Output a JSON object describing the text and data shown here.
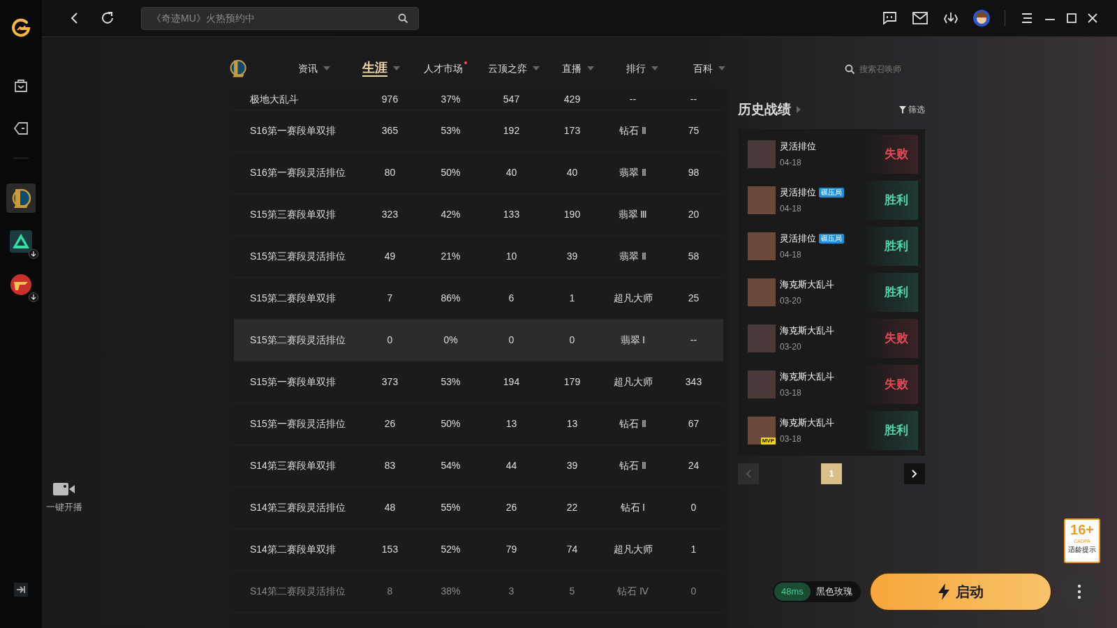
{
  "sidebar": {
    "games": [
      {
        "kind": "lol",
        "selected": true,
        "download": false
      },
      {
        "kind": "triangle",
        "selected": false,
        "download": true
      },
      {
        "kind": "cf",
        "selected": false,
        "download": true
      }
    ],
    "live_button": {
      "label": "一键开播"
    }
  },
  "top_bar": {
    "search": {
      "placeholder": "《奇迹MU》火热预约中"
    }
  },
  "nav": {
    "tabs": [
      {
        "label": "资讯",
        "selected": false,
        "dropdown": true,
        "dot": false
      },
      {
        "label": "生涯",
        "selected": true,
        "dropdown": true,
        "dot": false
      },
      {
        "label": "人才市场",
        "selected": false,
        "dropdown": false,
        "dot": true
      },
      {
        "label": "云顶之弈",
        "selected": false,
        "dropdown": true,
        "dot": false
      },
      {
        "label": "直播",
        "selected": false,
        "dropdown": true,
        "dot": false
      },
      {
        "label": "排行",
        "selected": false,
        "dropdown": true,
        "dot": false
      },
      {
        "label": "百科",
        "selected": false,
        "dropdown": true,
        "dot": false
      }
    ],
    "search": {
      "placeholder": "搜索召唤师"
    }
  },
  "table": {
    "rows": [
      {
        "cells": [
          "极地大乱斗",
          "976",
          "37%",
          "547",
          "429",
          "--",
          "--"
        ],
        "highlighted": false,
        "dimmed": false
      },
      {
        "cells": [
          "S16第一赛段单双排",
          "365",
          "53%",
          "192",
          "173",
          "钻石 Ⅱ",
          "75"
        ],
        "highlighted": false,
        "dimmed": false
      },
      {
        "cells": [
          "S16第一赛段灵活排位",
          "80",
          "50%",
          "40",
          "40",
          "翡翠 Ⅱ",
          "98"
        ],
        "highlighted": false,
        "dimmed": false
      },
      {
        "cells": [
          "S15第三赛段单双排",
          "323",
          "42%",
          "133",
          "190",
          "翡翠 Ⅲ",
          "20"
        ],
        "highlighted": false,
        "dimmed": false
      },
      {
        "cells": [
          "S15第三赛段灵活排位",
          "49",
          "21%",
          "10",
          "39",
          "翡翠 Ⅱ",
          "58"
        ],
        "highlighted": false,
        "dimmed": false
      },
      {
        "cells": [
          "S15第二赛段单双排",
          "7",
          "86%",
          "6",
          "1",
          "超凡大师",
          "25"
        ],
        "highlighted": false,
        "dimmed": false
      },
      {
        "cells": [
          "S15第二赛段灵活排位",
          "0",
          "0%",
          "0",
          "0",
          "翡翠 Ⅰ",
          "--"
        ],
        "highlighted": true,
        "dimmed": false
      },
      {
        "cells": [
          "S15第一赛段单双排",
          "373",
          "53%",
          "194",
          "179",
          "超凡大师",
          "343"
        ],
        "highlighted": false,
        "dimmed": false
      },
      {
        "cells": [
          "S15第一赛段灵活排位",
          "26",
          "50%",
          "13",
          "13",
          "钻石 Ⅱ",
          "67"
        ],
        "highlighted": false,
        "dimmed": false
      },
      {
        "cells": [
          "S14第三赛段单双排",
          "83",
          "54%",
          "44",
          "39",
          "钻石 Ⅱ",
          "24"
        ],
        "highlighted": false,
        "dimmed": false
      },
      {
        "cells": [
          "S14第三赛段灵活排位",
          "48",
          "55%",
          "26",
          "22",
          "钻石 Ⅰ",
          "0"
        ],
        "highlighted": false,
        "dimmed": false
      },
      {
        "cells": [
          "S14第二赛段单双排",
          "153",
          "52%",
          "79",
          "74",
          "超凡大师",
          "1"
        ],
        "highlighted": false,
        "dimmed": false
      },
      {
        "cells": [
          "S14第二赛段灵活排位",
          "8",
          "38%",
          "3",
          "5",
          "钻石 Ⅳ",
          "0"
        ],
        "highlighted": false,
        "dimmed": true
      }
    ]
  },
  "history": {
    "title": "历史战绩",
    "filter": "筛选",
    "matches": [
      {
        "mode": "灵活排位",
        "date": "04-18",
        "result": "失败",
        "win": false,
        "mvp": false
      },
      {
        "mode": "灵活排位",
        "tag": "碾压局",
        "date": "04-18",
        "result": "胜利",
        "win": true,
        "mvp": false
      },
      {
        "mode": "灵活排位",
        "tag": "碾压局",
        "date": "04-18",
        "result": "胜利",
        "win": true,
        "mvp": false
      },
      {
        "mode": "海克斯大乱斗",
        "date": "03-20",
        "result": "胜利",
        "win": true,
        "mvp": false
      },
      {
        "mode": "海克斯大乱斗",
        "date": "03-20",
        "result": "失败",
        "win": false,
        "mvp": false
      },
      {
        "mode": "海克斯大乱斗",
        "date": "03-18",
        "result": "失败",
        "win": false,
        "mvp": false
      },
      {
        "mode": "海克斯大乱斗",
        "date": "03-18",
        "result": "胜利",
        "win": true,
        "mvp": true,
        "mvp_label": "MVP"
      }
    ],
    "pagination": {
      "prev_disabled": true,
      "pages": [
        {
          "label": "1",
          "selected": true
        }
      ]
    }
  },
  "footer": {
    "ping": "48ms",
    "server": "黑色玫瑰",
    "launch": "启动"
  },
  "age_badge": {
    "rating": "16+",
    "org": "CADPA",
    "caption": "适龄提示"
  }
}
